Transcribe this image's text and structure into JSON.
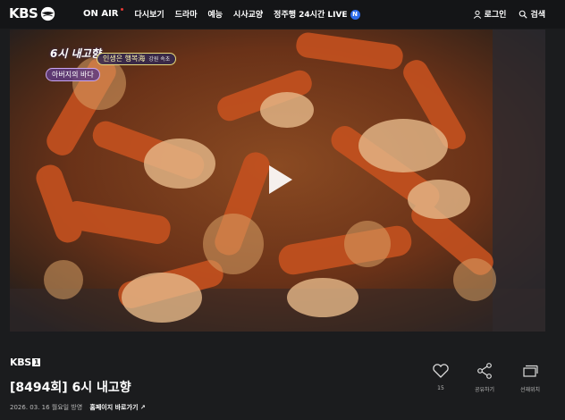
{
  "header": {
    "logo": "KBS",
    "nav": [
      {
        "label": "ON AIR"
      },
      {
        "label": "다시보기"
      },
      {
        "label": "드라마"
      },
      {
        "label": "예능"
      },
      {
        "label": "시사교양"
      },
      {
        "label": "정주행 24시간 LIVE",
        "badge": "N"
      }
    ],
    "login": "로그인",
    "search": "검색"
  },
  "video": {
    "program_logo": "6시 내고향",
    "pill_text": "인생은 행복海",
    "pill_sub": "강원 속초",
    "segment_title": "아버지의 바다"
  },
  "info": {
    "channel": "KBS",
    "channel_num": "1",
    "title": "[8494회] 6시 내고향",
    "date": "2026. 03. 16 월요일 방영",
    "homepage_link": "홈페이지 바로가기",
    "like_count": "15",
    "share_label": "공유하기",
    "save_label": "선재위치"
  },
  "colors": {
    "background": "#1b1c1e",
    "header": "#141517",
    "onair_dot": "#e53935",
    "new_badge": "#2d6bea"
  }
}
